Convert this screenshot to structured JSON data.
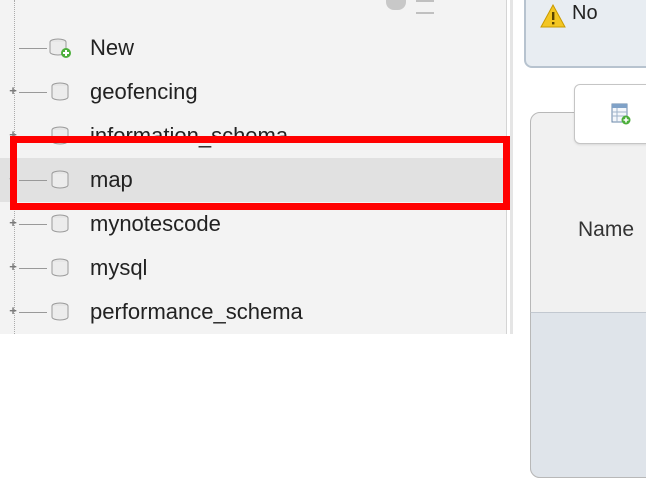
{
  "nav": {
    "items": [
      {
        "label": "New",
        "kind": "new",
        "expander": ""
      },
      {
        "label": "geofencing",
        "kind": "db",
        "expander": "+"
      },
      {
        "label": "information_schema",
        "kind": "db",
        "expander": "+"
      },
      {
        "label": "map",
        "kind": "db",
        "expander": "−",
        "selected": true
      },
      {
        "label": "mynotescode",
        "kind": "db",
        "expander": "+"
      },
      {
        "label": "mysql",
        "kind": "db",
        "expander": "+"
      },
      {
        "label": "performance_schema",
        "kind": "db",
        "expander": "+"
      }
    ]
  },
  "notice": {
    "text": "No",
    "icon": "warning-icon"
  },
  "panel": {
    "name_label": "Name"
  },
  "colors": {
    "highlight_frame": "#ff0000",
    "selected_row": "#e1e1e1"
  }
}
